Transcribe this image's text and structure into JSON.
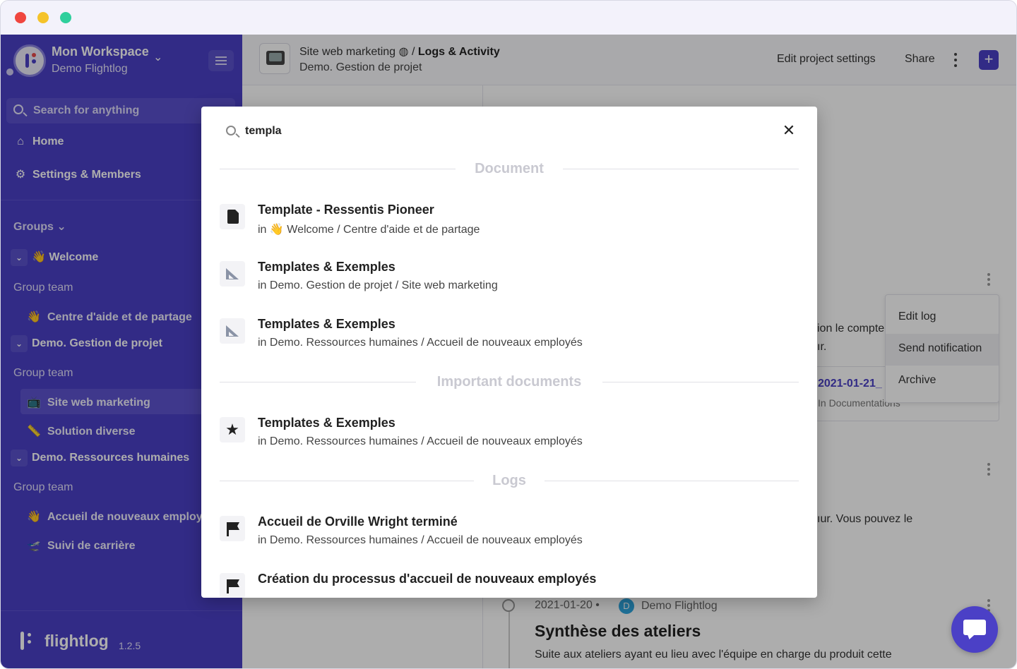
{
  "workspace": {
    "name": "Mon Workspace",
    "subtitle": "Demo Flightlog"
  },
  "sidebar": {
    "search_placeholder": "Search for anything",
    "home": "Home",
    "settings": "Settings & Members",
    "groups_label": "Groups",
    "groups": [
      {
        "name": "Welcome",
        "emoji": "👋",
        "team_label": "Group team",
        "pages": [
          {
            "emoji": "👋",
            "label": "Centre d'aide et de partage"
          }
        ]
      },
      {
        "name": "Demo. Gestion de projet",
        "team_label": "Group team",
        "pages": [
          {
            "emoji": "📺",
            "label": "Site web marketing"
          },
          {
            "emoji": "📏",
            "label": "Solution diverse"
          }
        ]
      },
      {
        "name": "Demo. Ressources humaines",
        "team_label": "Group team",
        "pages": [
          {
            "emoji": "👋",
            "label": "Accueil de nouveaux employé"
          },
          {
            "emoji": "🛫",
            "label": "Suivi de carrière"
          }
        ]
      }
    ],
    "brand": "flightlog",
    "version": "1.2.5"
  },
  "header": {
    "project": "Site web marketing",
    "separator": "/",
    "page": "Logs & Activity",
    "sub": "Demo. Gestion de projet",
    "edit_settings": "Edit project settings",
    "share": "Share",
    "plus": "+"
  },
  "background": {
    "menu": {
      "items": [
        "Edit log",
        "Send notification",
        "Archive"
      ]
    },
    "text_1": "ion le compte",
    "text_2": "ır.",
    "link_1": "2021-01-21_",
    "small_1": "In Documentations",
    "text_3": "ıur. Vous pouvez le",
    "log_date": "2021-01-20",
    "log_sep": "•",
    "log_avatar": "D",
    "log_author": "Demo Flightlog",
    "log_title": "Synthèse des ateliers",
    "log_body": "Suite aux ateliers ayant eu lieu avec l'équipe en charge du produit cette"
  },
  "modal": {
    "query": "templa",
    "close": "✕",
    "sections": [
      {
        "title": "Document",
        "results": [
          {
            "icon": "document-icon",
            "title": "Template - Ressentis Pioneer",
            "path_prefix": "in",
            "path_emoji": "👋",
            "path": "Welcome / Centre d'aide et de partage"
          },
          {
            "icon": "set-square-icon",
            "title": "Templates & Exemples",
            "path_prefix": "in",
            "path": "Demo. Gestion de projet / Site web marketing"
          },
          {
            "icon": "set-square-icon",
            "title": "Templates & Exemples",
            "path_prefix": "in",
            "path": "Demo. Ressources humaines / Accueil de nouveaux employés"
          }
        ]
      },
      {
        "title": "Important documents",
        "results": [
          {
            "icon": "star-icon",
            "title": "Templates & Exemples",
            "path_prefix": "in",
            "path": "Demo. Ressources humaines / Accueil de nouveaux employés"
          }
        ]
      },
      {
        "title": "Logs",
        "results": [
          {
            "icon": "flag-icon",
            "title": "Accueil de Orville Wright terminé",
            "path_prefix": "in",
            "path": "Demo. Ressources humaines / Accueil de nouveaux employés"
          },
          {
            "icon": "flag-icon",
            "title": "Création du processus d'accueil de nouveaux employés",
            "path_prefix": "",
            "path": ""
          }
        ]
      }
    ]
  },
  "colors": {
    "brand": "#4b40c6",
    "accent_link": "#4b40c6",
    "overlay": "rgba(0,0,0,0.32)"
  }
}
